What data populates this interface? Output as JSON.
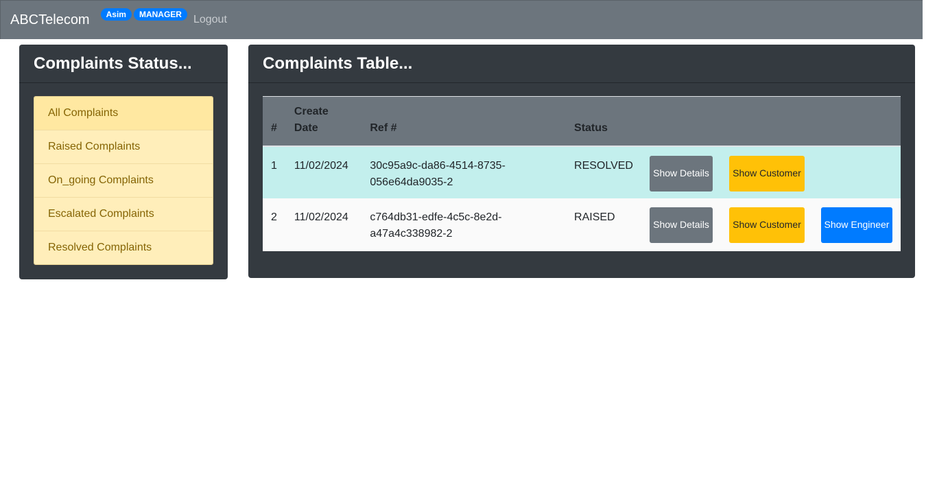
{
  "navbar": {
    "brand": "ABCTelecom",
    "user_badge": "Asim",
    "role_badge": "MANAGER",
    "logout": "Logout"
  },
  "status_card": {
    "title": "Complaints Status...",
    "items": [
      {
        "label": "All Complaints"
      },
      {
        "label": "Raised Complaints"
      },
      {
        "label": "On_going Complaints"
      },
      {
        "label": "Escalated Complaints"
      },
      {
        "label": "Resolved Complaints"
      }
    ]
  },
  "table_card": {
    "title": "Complaints Table...",
    "columns": [
      "#",
      "Create Date",
      "Ref #",
      "Status"
    ],
    "rows": [
      {
        "num": "1",
        "date": "11/02/2024",
        "ref_line1": "30c95a9c-da86-4514-8735-",
        "ref_line2": "056e64da9035-2",
        "status": "RESOLVED",
        "btn_details": "Show Details",
        "btn_customer": "Show Customer"
      },
      {
        "num": "2",
        "date": "11/02/2024",
        "ref_line1": "c764db31-edfe-4c5c-8e2d-",
        "ref_line2": "a47a4c338982-2",
        "status": "RAISED",
        "btn_details": "Show Details",
        "btn_customer": "Show Customer",
        "btn_engineer": "Show Engineer"
      }
    ]
  },
  "colors": {
    "navbar": "#6c757d",
    "card": "#343a40",
    "list_item": "#ffeeba",
    "row_resolved": "#c3efed",
    "btn_secondary": "#6c757d",
    "btn_warning": "#ffc107",
    "btn_primary": "#007bff"
  }
}
